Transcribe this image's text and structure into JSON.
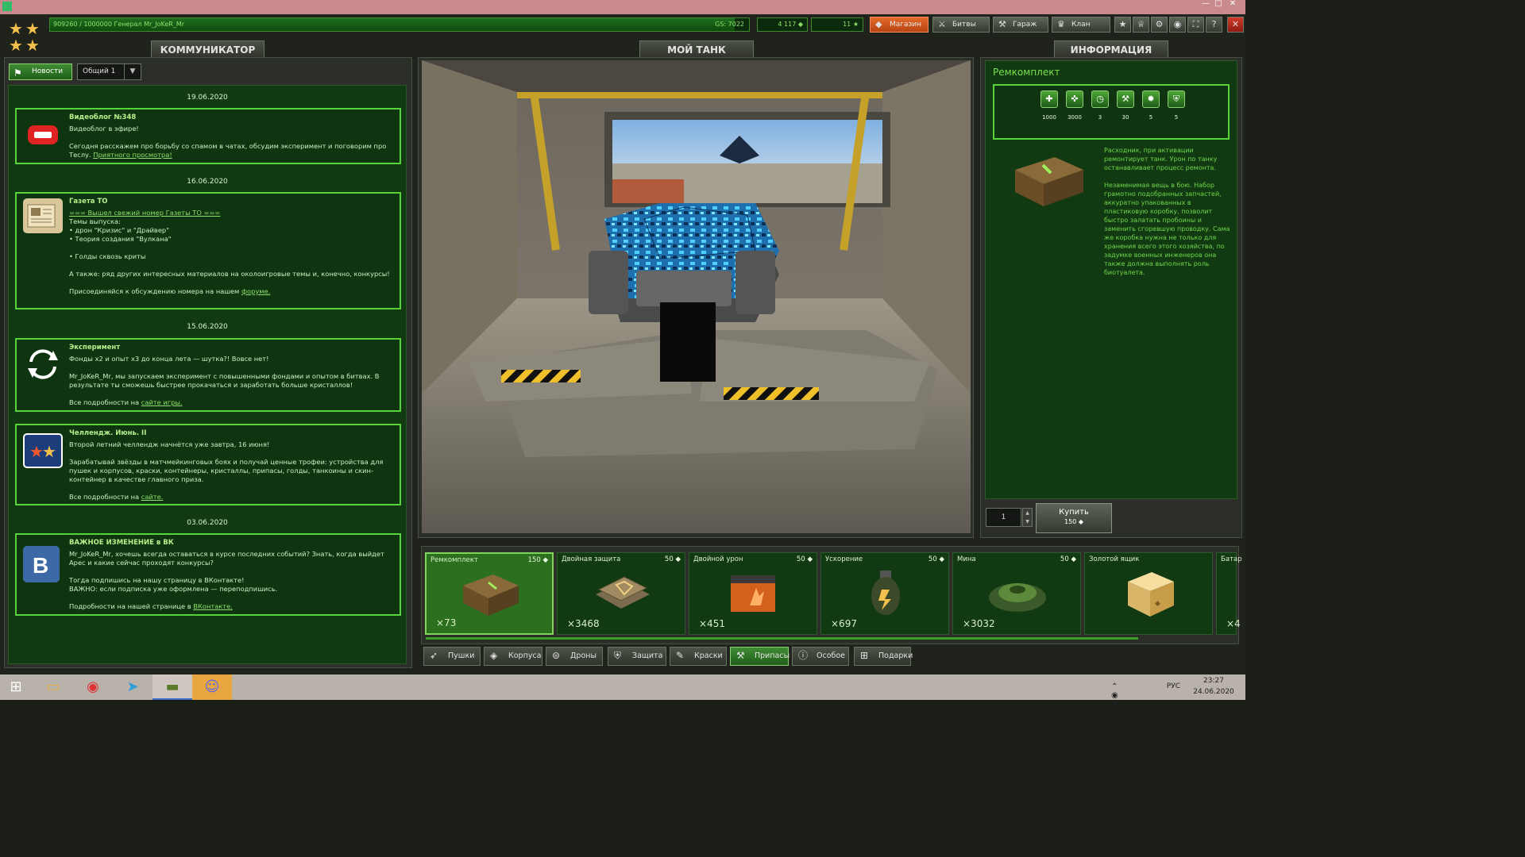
{
  "window": {
    "minimize": "—",
    "maximize": "□",
    "close": "✕"
  },
  "top": {
    "xp_text": "909260 / 1000000  Генерал Mr_JoKeR_Mr",
    "gs": "GS: 7022",
    "crystals": "4 117",
    "stars": "11",
    "buttons": [
      "Магазин",
      "Битвы",
      "Гараж",
      "Клан"
    ],
    "icons": [
      "star-icon",
      "achievements-icon",
      "settings-icon",
      "sound-icon",
      "fullscreen-icon",
      "help-icon",
      "close-icon"
    ]
  },
  "communicator": {
    "tab": "КОММУНИКАТОР",
    "news_button": "Новости",
    "channel": "Общий 1",
    "items": [
      {
        "date": "19.06.2020",
        "title": "Видеоблог №348",
        "body": "Видеоблог в эфире!\n\nСегодня расскажем про борьбу со спамом в чатах, обсудим эксперимент и поговорим про Теслу. ",
        "link": "Приятного просмотра!",
        "tail": ""
      },
      {
        "date": "16.06.2020",
        "title": "Газета ТО",
        "body": "",
        "link": "=== Вышел свежий номер Газеты ТО ===",
        "tail": "\nТемы выпуска:\n• дрон \"Кризис\" и \"Драйвер\"\n• Теория создания \"Вулкана\"\n\n• Голды сквозь криты\n\nА также: ряд других интересных материалов на околоигровые темы и, конечно, конкурсы!\n\nПрисоединяйся к обсуждению номера на нашем ",
        "link2": "форуме."
      },
      {
        "date": "15.06.2020",
        "title": "Эксперимент",
        "body": "Фонды x2 и опыт x3 до конца лета — шутка?! Вовсе нет!\n\nMr_JoKeR_Mr, мы запускаем эксперимент с повышенными фондами и опытом в битвах. В результате ты сможешь быстрее прокачаться и заработать больше кристаллов!\n\nВсе подробности на ",
        "link": "сайте игры.",
        "tail": ""
      },
      {
        "date": "",
        "title": "Челлендж. Июнь. II",
        "body": "Второй летний челлендж начнётся уже завтра, 16 июня!\n\nЗарабатывай звёзды в матчмейкинговых боях и получай ценные трофеи: устройства для пушек и корпусов, краски, контейнеры, кристаллы, припасы, голды, танкоины и скин-контейнер в качестве главного приза.\n\nВсе подробности на  ",
        "link": "сайте.",
        "tail": ""
      },
      {
        "date": "03.06.2020",
        "title": "ВАЖНОЕ ИЗМЕНЕНИЕ в ВК",
        "body": "Mr_JoKeR_Mr, хочешь всегда оставаться в курсе последних событий? Знать, когда выйдет Арес и какие сейчас проходят конкурсы?\n\nТогда подпишись на нашу страницу в ВКонтакте!\nВАЖНО: если подписка уже оформлена — переподпишись.\n\nПодробности на нашей странице в ",
        "link": "ВКонтакте.",
        "tail": ""
      }
    ]
  },
  "tank": {
    "tab": "МОЙ ТАНК"
  },
  "info": {
    "tab": "ИНФОРМАЦИЯ",
    "title": "Ремкомплект",
    "props": [
      "1000",
      "3000",
      "3",
      "30",
      "5",
      "5"
    ],
    "prop_icons": [
      "heal-icon",
      "heal-plus-icon",
      "cooldown-icon",
      "repair-icon",
      "fire-icon",
      "shield-icon"
    ],
    "description": "Расходник, при активации ремонтирует танк. Урон по танку останавливает процесс ремонта.\n\nНезаменимая вещь в бою. Набор грамотно подобранных запчастей, аккуратно упакованных в пластиковую коробку, позволит быстро залатать пробоины и заменить сгоревшую проводку. Сама же коробка нужна не только для хранения всего этого хозяйства, по задумке военных инженеров она также должна выполнять роль биотуалета.",
    "quantity": "1",
    "buy_label": "Купить",
    "buy_price": "150"
  },
  "items": [
    {
      "name": "Ремкомплект",
      "price": "150",
      "count": "×73"
    },
    {
      "name": "Двойная защита",
      "price": "50",
      "count": "×3468"
    },
    {
      "name": "Двойной урон",
      "price": "50",
      "count": "×451"
    },
    {
      "name": "Ускорение",
      "price": "50",
      "count": "×697"
    },
    {
      "name": "Мина",
      "price": "50",
      "count": "×3032"
    },
    {
      "name": "Золотой ящик",
      "price": "",
      "count": ""
    },
    {
      "name": "Батар",
      "price": "",
      "count": "×4"
    }
  ],
  "categories": [
    "Пушки",
    "Корпуса",
    "Дроны",
    "Защита",
    "Краски",
    "Припасы",
    "Особое",
    "Подарки"
  ],
  "taskbar": {
    "lang": "РУС",
    "time": "23:27",
    "date": "24.06.2020"
  },
  "colors": {
    "accent": "#57d43a",
    "panel": "#123a12",
    "shop": "#e36a2a"
  }
}
